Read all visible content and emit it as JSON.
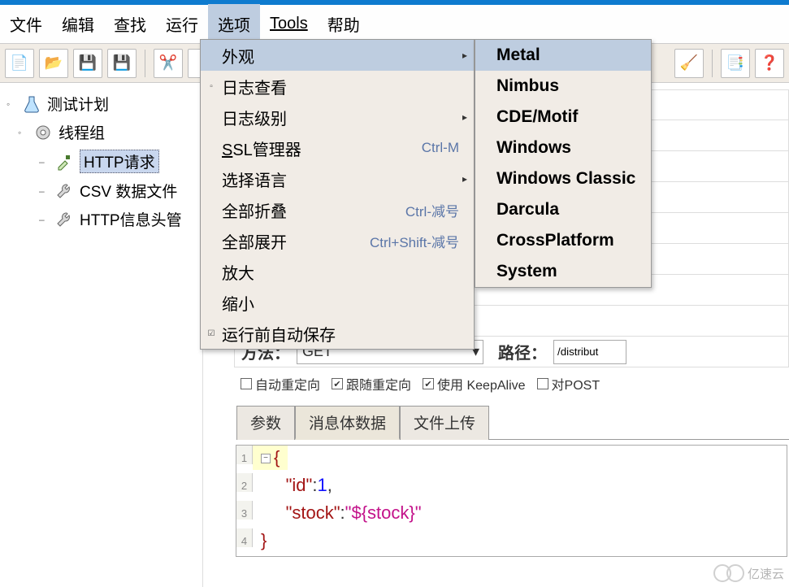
{
  "menubar": {
    "items": [
      "文件",
      "编辑",
      "查找",
      "运行",
      "选项",
      "Tools",
      "帮助"
    ],
    "active_index": 4
  },
  "toolbar_icons": [
    "📄",
    "📂",
    "💾",
    "💾",
    "✂️"
  ],
  "toolbar_right_icons": [
    "🧹",
    "📑",
    "❓"
  ],
  "tree": {
    "root": {
      "label": "测试计划",
      "icon": "flask"
    },
    "group": {
      "label": "线程组",
      "icon": "gear"
    },
    "children": [
      {
        "label": "HTTP请求",
        "icon": "dropper",
        "selected": true
      },
      {
        "label": "CSV 数据文件",
        "icon": "wrench"
      },
      {
        "label": "HTTP信息头管",
        "icon": "wrench"
      }
    ]
  },
  "options_menu": [
    {
      "label": "外观",
      "submenu": true,
      "selected": true
    },
    {
      "label": "日志查看",
      "check": "box"
    },
    {
      "label": "日志级别",
      "submenu": true
    },
    {
      "label": "SSL管理器",
      "shortcut": "Ctrl-M",
      "underline_first": true
    },
    {
      "label": "选择语言",
      "submenu": true
    },
    {
      "label": "全部折叠",
      "shortcut": "Ctrl-减号"
    },
    {
      "label": "全部展开",
      "shortcut": "Ctrl+Shift-减号"
    },
    {
      "label": "放大"
    },
    {
      "label": "缩小"
    },
    {
      "label": "运行前自动保存",
      "check": "checked"
    }
  ],
  "themes_menu": [
    {
      "label": "Metal",
      "selected": true
    },
    {
      "label": "Nimbus"
    },
    {
      "label": "CDE/Motif"
    },
    {
      "label": "Windows"
    },
    {
      "label": "Windows Classic"
    },
    {
      "label": "Darcula"
    },
    {
      "label": "CrossPlatform"
    },
    {
      "label": "System"
    }
  ],
  "form": {
    "method_label": "方法：",
    "method_value": "GET",
    "path_label": "路径：",
    "path_value": "/distribut"
  },
  "checks": [
    {
      "label": "自动重定向",
      "checked": false
    },
    {
      "label": "跟随重定向",
      "checked": true
    },
    {
      "label": "使用 KeepAlive",
      "checked": true
    },
    {
      "label": "对POST",
      "checked": false
    }
  ],
  "tabs": {
    "items": [
      "参数",
      "消息体数据",
      "文件上传"
    ],
    "active_index": 1
  },
  "editor_lines": [
    {
      "n": 1,
      "t": "{",
      "type": "brace",
      "hl": true,
      "fold": true
    },
    {
      "n": 2,
      "t": "     \"id\":1,",
      "type": "kv_num"
    },
    {
      "n": 3,
      "t": "     \"stock\":\"${stock}\"",
      "type": "kv_str"
    },
    {
      "n": 4,
      "t": "}",
      "type": "brace"
    }
  ],
  "watermark": "亿速云"
}
